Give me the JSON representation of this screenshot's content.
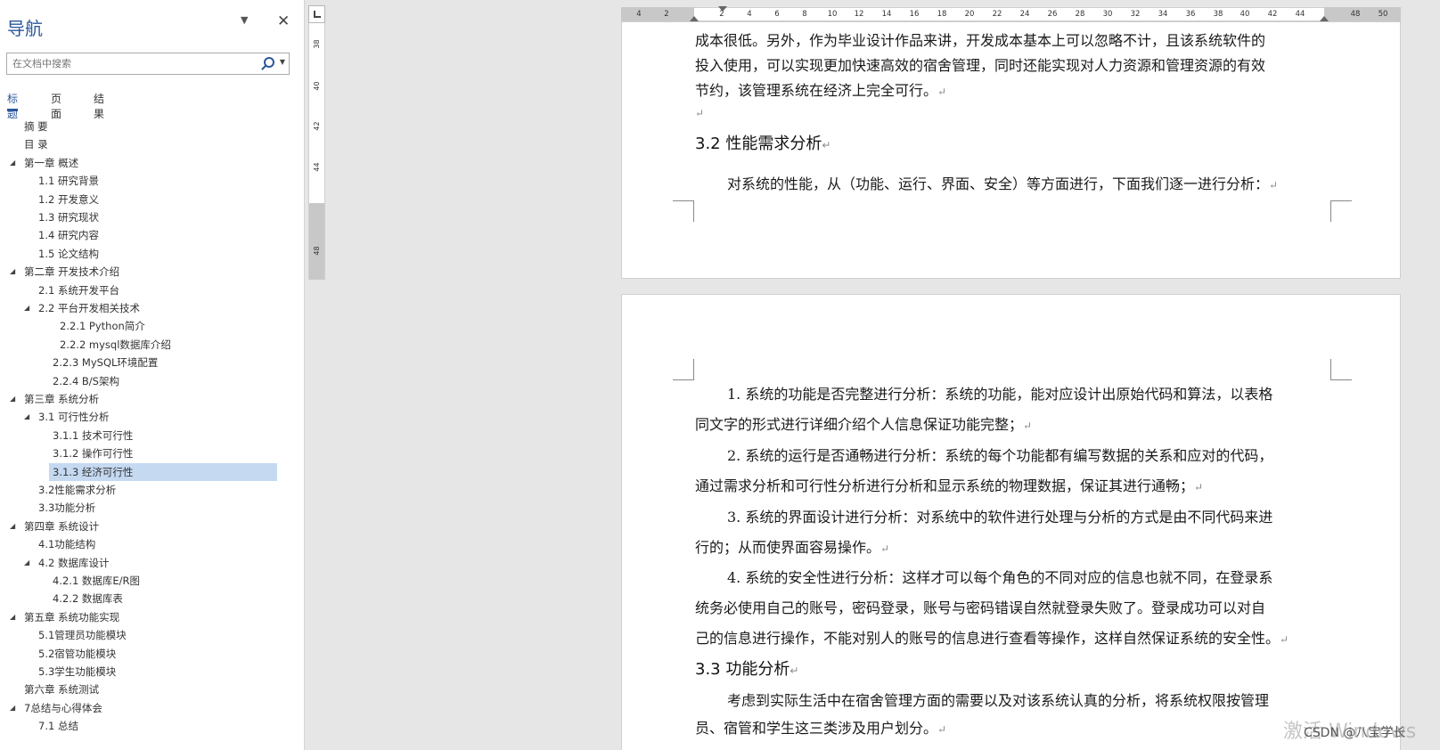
{
  "nav": {
    "title": "导航",
    "search_placeholder": "在文档中搜索",
    "tabs": [
      "标题",
      "页面",
      "结果"
    ],
    "outline": [
      {
        "label": "摘  要",
        "level": 1,
        "caret": false
      },
      {
        "label": "目  录",
        "level": 1,
        "caret": false
      },
      {
        "label": "第一章 概述",
        "level": 1,
        "caret": true
      },
      {
        "label": "1.1 研究背景",
        "level": 2,
        "caret": false
      },
      {
        "label": "1.2 开发意义",
        "level": 2,
        "caret": false
      },
      {
        "label": "1.3 研究现状",
        "level": 2,
        "caret": false
      },
      {
        "label": "1.4 研究内容",
        "level": 2,
        "caret": false
      },
      {
        "label": "1.5 论文结构",
        "level": 2,
        "caret": false
      },
      {
        "label": "第二章 开发技术介绍",
        "level": 1,
        "caret": true
      },
      {
        "label": "2.1 系统开发平台",
        "level": 2,
        "caret": false
      },
      {
        "label": "2.2 平台开发相关技术",
        "level": 2,
        "caret": true
      },
      {
        "label": "2.2.1  Python简介",
        "level": 4,
        "caret": false
      },
      {
        "label": "2.2.2  mysql数据库介绍",
        "level": 4,
        "caret": false
      },
      {
        "label": "2.2.3  MySQL环境配置",
        "level": 3,
        "caret": false
      },
      {
        "label": "2.2.4  B/S架构",
        "level": 3,
        "caret": false
      },
      {
        "label": "第三章 系统分析",
        "level": 1,
        "caret": true
      },
      {
        "label": "3.1 可行性分析",
        "level": 2,
        "caret": true
      },
      {
        "label": "3.1.1 技术可行性",
        "level": 3,
        "caret": false
      },
      {
        "label": "3.1.2 操作可行性",
        "level": 3,
        "caret": false
      },
      {
        "label": "3.1.3 经济可行性",
        "level": 3,
        "caret": false,
        "selected": true
      },
      {
        "label": "3.2性能需求分析",
        "level": 2,
        "caret": false
      },
      {
        "label": "3.3功能分析",
        "level": 2,
        "caret": false
      },
      {
        "label": "第四章 系统设计",
        "level": 1,
        "caret": true
      },
      {
        "label": "4.1功能结构",
        "level": 2,
        "caret": false
      },
      {
        "label": "4.2 数据库设计",
        "level": 2,
        "caret": true
      },
      {
        "label": "4.2.1 数据库E/R图",
        "level": 3,
        "caret": false
      },
      {
        "label": "4.2.2 数据库表",
        "level": 3,
        "caret": false
      },
      {
        "label": "第五章 系统功能实现",
        "level": 1,
        "caret": true
      },
      {
        "label": "5.1管理员功能模块",
        "level": 2,
        "caret": false
      },
      {
        "label": "5.2宿管功能模块",
        "level": 2,
        "caret": false
      },
      {
        "label": "5.3学生功能模块",
        "level": 2,
        "caret": false
      },
      {
        "label": "第六章 系统测试",
        "level": 1,
        "caret": false
      },
      {
        "label": "7总结与心得体会",
        "level": 1,
        "caret": true
      },
      {
        "label": "7.1 总结",
        "level": 2,
        "caret": false
      }
    ]
  },
  "ruler": {
    "h_labels": [
      "4",
      "2",
      "2",
      "4",
      "6",
      "8",
      "10",
      "12",
      "14",
      "16",
      "18",
      "20",
      "22",
      "24",
      "26",
      "28",
      "30",
      "32",
      "34",
      "36",
      "38",
      "40",
      "42",
      "44",
      "48",
      "50"
    ],
    "v_labels": [
      "38",
      "40",
      "42",
      "44",
      "48"
    ]
  },
  "doc": {
    "page1_lines": [
      "成本很低。另外，作为毕业设计作品来讲，开发成本基本上可以忽略不计，且该系统软件的",
      "投入使用，可以实现更加快速高效的宿舍管理，同时还能实现对人力资源和管理资源的有效",
      "节约，该管理系统在经济上完全可行。"
    ],
    "heading_32": "3.2 性能需求分析",
    "para_32": "对系统的性能，从（功能、运行、界面、安全）等方面进行，下面我们逐一进行分析：",
    "page2_lines": [
      "1. 系统的功能是否完整进行分析：系统的功能，能对应设计出原始代码和算法，以表格",
      "同文字的形式进行详细介绍个人信息保证功能完整；",
      "2. 系统的运行是否通畅进行分析：系统的每个功能都有编写数据的关系和应对的代码，",
      "通过需求分析和可行性分析进行分析和显示系统的物理数据，保证其进行通畅；",
      "3. 系统的界面设计进行分析：对系统中的软件进行处理与分析的方式是由不同代码来进",
      "行的；从而使界面容易操作。",
      "4. 系统的安全性进行分析：这样才可以每个角色的不同对应的信息也就不同，在登录系",
      "统务必使用自己的账号，密码登录，账号与密码错误自然就登录失败了。登录成功可以对自",
      "己的信息进行操作，不能对别人的账号的信息进行查看等操作，这样自然保证系统的安全性。"
    ],
    "heading_33": "3.3 功能分析",
    "para_33_lines": [
      "考虑到实际生活中在宿舍管理方面的需要以及对该系统认真的分析，将系统权限按管理",
      "员、宿管和学生这三类涉及用户划分。"
    ],
    "para_mark": "↵"
  },
  "overlay": {
    "watermark": "激活 Windows",
    "csdn": "CSDN @八宝学长"
  }
}
